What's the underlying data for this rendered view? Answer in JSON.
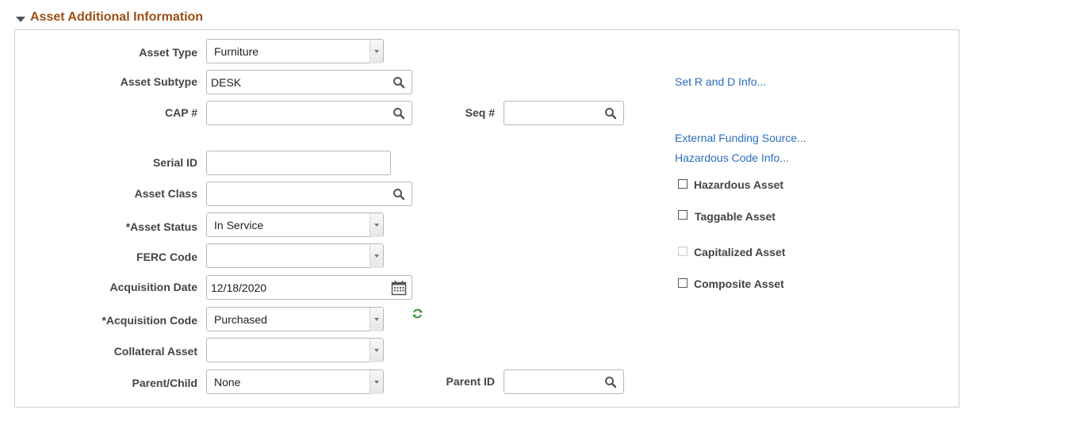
{
  "section": {
    "title": "Asset Additional Information"
  },
  "fields": {
    "asset_type": {
      "label": "Asset Type",
      "value": "Furniture"
    },
    "asset_subtype": {
      "label": "Asset Subtype",
      "value": "DESK"
    },
    "cap": {
      "label": "CAP #",
      "value": ""
    },
    "seq": {
      "label": "Seq #",
      "value": ""
    },
    "serial_id": {
      "label": "Serial ID",
      "value": ""
    },
    "asset_class": {
      "label": "Asset Class",
      "value": ""
    },
    "asset_status": {
      "label": "*Asset Status",
      "value": "In Service"
    },
    "ferc_code": {
      "label": "FERC Code",
      "value": ""
    },
    "acquisition_date": {
      "label": "Acquisition Date",
      "value": "12/18/2020"
    },
    "acquisition_code": {
      "label": "*Acquisition Code",
      "value": "Purchased"
    },
    "collateral_asset": {
      "label": "Collateral Asset",
      "value": ""
    },
    "parent_child": {
      "label": "Parent/Child",
      "value": "None"
    },
    "parent_id": {
      "label": "Parent ID",
      "value": ""
    }
  },
  "links": {
    "set_rd": "Set R and D Info...",
    "external_funding": "External Funding Source...",
    "hazardous_code": "Hazardous Code Info..."
  },
  "checkboxes": {
    "hazardous": {
      "label": "Hazardous Asset",
      "checked": false
    },
    "taggable": {
      "label": "Taggable Asset",
      "checked": false
    },
    "capitalized": {
      "label": "Capitalized Asset",
      "checked": false,
      "disabled": true
    },
    "composite": {
      "label": "Composite Asset",
      "checked": false
    }
  },
  "icons": {
    "collapse": "triangle-down-icon",
    "lookup": "magnifier-icon",
    "calendar": "calendar-icon",
    "refresh": "refresh-icon"
  },
  "colors": {
    "section_title": "#9a4f16",
    "link": "#2a6ebb",
    "refresh": "#3a9a3a"
  }
}
